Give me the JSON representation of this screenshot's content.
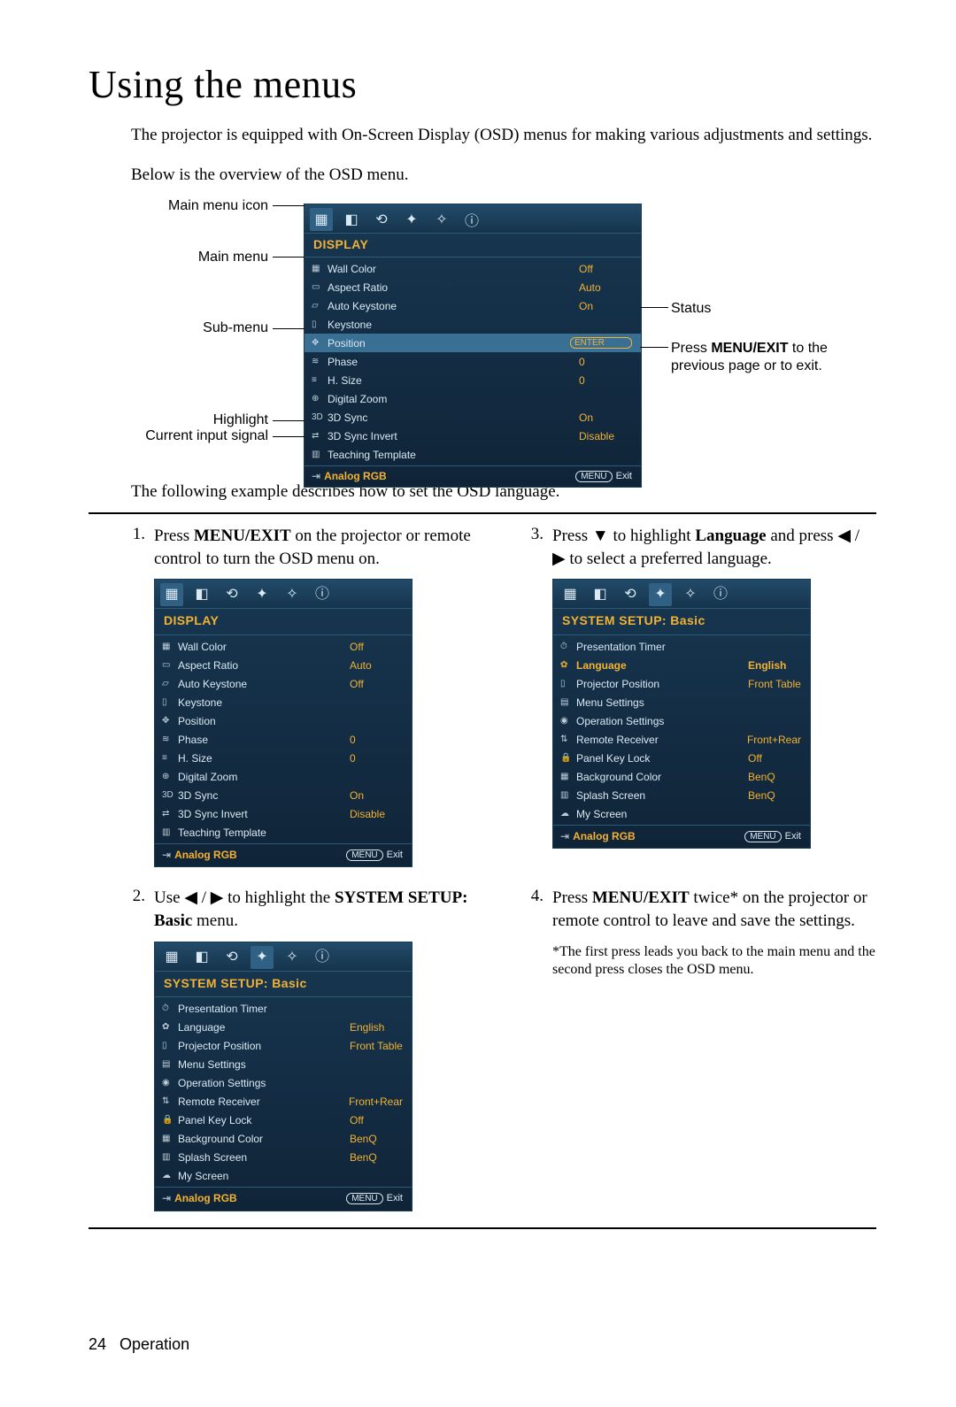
{
  "page": {
    "heading": "Using the menus",
    "intro": "The projector is equipped with On-Screen Display (OSD) menus for making various adjustments and settings.",
    "overview": "Below is the overview of the OSD menu.",
    "example_intro": "The following example describes how to set the OSD language.",
    "footer_num": "24",
    "footer_label": "Operation"
  },
  "labels": {
    "main_menu_icon": "Main menu icon",
    "main_menu": "Main menu",
    "sub_menu": "Sub-menu",
    "highlight": "Highlight",
    "current_input": "Current input signal",
    "status": "Status",
    "press_menu_1": "Press ",
    "press_menu_bold": "MENU/EXIT",
    "press_menu_2": " to the previous page or to exit."
  },
  "osd_main": {
    "title": "DISPLAY",
    "source": "Analog RGB",
    "exit_menu": "MENU",
    "exit_label": "Exit",
    "items": [
      {
        "icon": "▦",
        "name": "Wall Color",
        "val": "Off"
      },
      {
        "icon": "▭",
        "name": "Aspect Ratio",
        "val": "Auto"
      },
      {
        "icon": "▱",
        "name": "Auto Keystone",
        "val": "On"
      },
      {
        "icon": "▯",
        "name": "Keystone",
        "val": ""
      },
      {
        "icon": "✥",
        "name": "Position",
        "val": "ENTER",
        "enter": true,
        "hl": true
      },
      {
        "icon": "≋",
        "name": "Phase",
        "val": "0"
      },
      {
        "icon": "≡",
        "name": "H. Size",
        "val": "0"
      },
      {
        "icon": "⊕",
        "name": "Digital Zoom",
        "val": ""
      },
      {
        "icon": "3D",
        "name": "3D Sync",
        "val": "On"
      },
      {
        "icon": "⇄",
        "name": "3D Sync Invert",
        "val": "Disable"
      },
      {
        "icon": "▥",
        "name": "Teaching Template",
        "val": ""
      }
    ]
  },
  "osd_display_small": {
    "title": "DISPLAY",
    "source": "Analog RGB",
    "exit_menu": "MENU",
    "exit_label": "Exit",
    "items": [
      {
        "icon": "▦",
        "name": "Wall Color",
        "val": "Off"
      },
      {
        "icon": "▭",
        "name": "Aspect Ratio",
        "val": "Auto"
      },
      {
        "icon": "▱",
        "name": "Auto Keystone",
        "val": "Off"
      },
      {
        "icon": "▯",
        "name": "Keystone",
        "val": ""
      },
      {
        "icon": "✥",
        "name": "Position",
        "val": ""
      },
      {
        "icon": "≋",
        "name": "Phase",
        "val": "0"
      },
      {
        "icon": "≡",
        "name": "H. Size",
        "val": "0"
      },
      {
        "icon": "⊕",
        "name": "Digital Zoom",
        "val": ""
      },
      {
        "icon": "3D",
        "name": "3D Sync",
        "val": "On"
      },
      {
        "icon": "⇄",
        "name": "3D Sync Invert",
        "val": "Disable"
      },
      {
        "icon": "▥",
        "name": "Teaching Template",
        "val": ""
      }
    ]
  },
  "osd_setup_1": {
    "title": "SYSTEM SETUP: Basic",
    "source": "Analog RGB",
    "exit_menu": "MENU",
    "exit_label": "Exit",
    "items": [
      {
        "icon": "⏱",
        "name": "Presentation Timer",
        "val": ""
      },
      {
        "icon": "✿",
        "name": "Language",
        "val": "English"
      },
      {
        "icon": "▯",
        "name": "Projector Position",
        "val": "Front Table"
      },
      {
        "icon": "▤",
        "name": "Menu Settings",
        "val": ""
      },
      {
        "icon": "◉",
        "name": "Operation Settings",
        "val": ""
      },
      {
        "icon": "⇅",
        "name": "Remote Receiver",
        "val": "Front+Rear"
      },
      {
        "icon": "🔒",
        "name": "Panel Key Lock",
        "val": "Off"
      },
      {
        "icon": "▦",
        "name": "Background Color",
        "val": "BenQ"
      },
      {
        "icon": "▥",
        "name": "Splash Screen",
        "val": "BenQ"
      },
      {
        "icon": "☁",
        "name": "My Screen",
        "val": ""
      }
    ]
  },
  "osd_setup_2": {
    "title": "SYSTEM SETUP: Basic",
    "source": "Analog RGB",
    "exit_menu": "MENU",
    "exit_label": "Exit",
    "items": [
      {
        "icon": "⏱",
        "name": "Presentation Timer",
        "val": ""
      },
      {
        "icon": "✿",
        "name": "Language",
        "val": "English",
        "orangehl": true
      },
      {
        "icon": "▯",
        "name": "Projector Position",
        "val": "Front Table"
      },
      {
        "icon": "▤",
        "name": "Menu Settings",
        "val": ""
      },
      {
        "icon": "◉",
        "name": "Operation Settings",
        "val": ""
      },
      {
        "icon": "⇅",
        "name": "Remote Receiver",
        "val": "Front+Rear"
      },
      {
        "icon": "🔒",
        "name": "Panel Key Lock",
        "val": "Off"
      },
      {
        "icon": "▦",
        "name": "Background Color",
        "val": "BenQ"
      },
      {
        "icon": "▥",
        "name": "Splash Screen",
        "val": "BenQ"
      },
      {
        "icon": "☁",
        "name": "My Screen",
        "val": ""
      }
    ]
  },
  "steps": {
    "s1_a": "Press ",
    "s1_b": "MENU/EXIT",
    "s1_c": " on the projector or remote control to turn the OSD menu on.",
    "s2_a": "Use ",
    "s2_b": " / ",
    "s2_c": " to highlight the ",
    "s2_d": "SYSTEM SETUP: Basic",
    "s2_e": " menu.",
    "s3_a": "Press ",
    "s3_b": " to highlight ",
    "s3_c": "Language",
    "s3_d": " and press ",
    "s3_e": " / ",
    "s3_f": " to select a preferred language.",
    "s4_a": "Press ",
    "s4_b": "MENU/EXIT",
    "s4_c": " twice* on the projector or remote control to leave and save the settings.",
    "s4_note": "*The first press leads you back to the main menu and the second press closes the OSD menu."
  },
  "tab_icons": [
    "tab1",
    "tab2",
    "tab3",
    "tab4",
    "tab5",
    "tab6"
  ]
}
